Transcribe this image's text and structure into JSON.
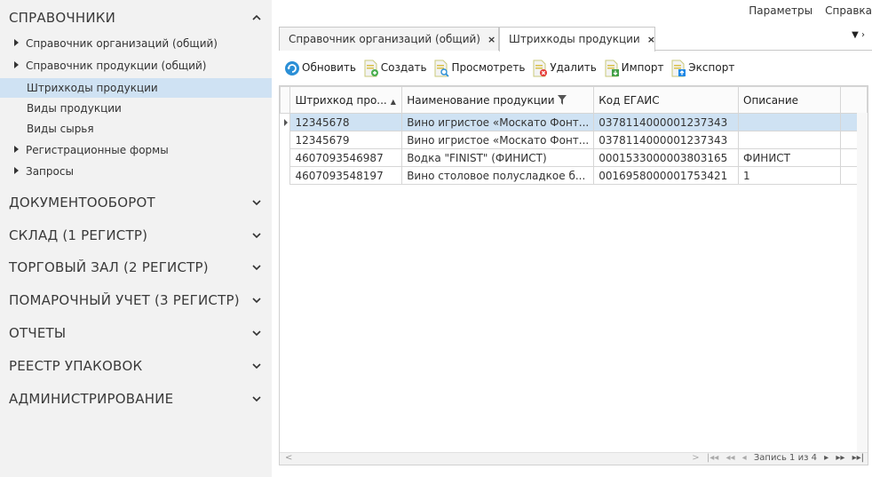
{
  "sidebar": {
    "sections": [
      {
        "label": "СПРАВОЧНИКИ",
        "expanded": true
      },
      {
        "label": "ДОКУМЕНТООБОРОТ",
        "expanded": false
      },
      {
        "label": "СКЛАД (1 РЕГИСТР)",
        "expanded": false
      },
      {
        "label": "ТОРГОВЫЙ ЗАЛ (2 РЕГИСТР)",
        "expanded": false
      },
      {
        "label": "ПОМАРОЧНЫЙ УЧЕТ (3 РЕГИСТР)",
        "expanded": false
      },
      {
        "label": "ОТЧЕТЫ",
        "expanded": false
      },
      {
        "label": "РЕЕСТР УПАКОВОК",
        "expanded": false
      },
      {
        "label": "АДМИНИСТРИРОВАНИЕ",
        "expanded": false
      }
    ],
    "items": [
      {
        "label": "Справочник организаций (общий)",
        "has_children": true
      },
      {
        "label": "Справочник продукции (общий)",
        "has_children": true
      },
      {
        "label": "Штрихкоды продукции",
        "selected": true
      },
      {
        "label": "Виды продукции"
      },
      {
        "label": "Виды сырья"
      },
      {
        "label": "Регистрационные формы",
        "has_children": true
      },
      {
        "label": "Запросы",
        "has_children": true
      }
    ]
  },
  "topmenu": {
    "params": "Параметры",
    "help": "Справка"
  },
  "tabs": [
    {
      "label": "Справочник организаций (общий)",
      "close": "×"
    },
    {
      "label": "Штрихкоды продукции",
      "close": "×",
      "active": true
    }
  ],
  "toolbar": {
    "refresh": "Обновить",
    "create": "Создать",
    "view": "Просмотреть",
    "delete": "Удалить",
    "import": "Импорт",
    "export": "Экспорт"
  },
  "table": {
    "columns": [
      "Штрихкод про...",
      "Наименование продукции",
      "Код ЕГАИС",
      "Описание"
    ],
    "rows": [
      [
        "12345678",
        "Вино игристое «Москато Фонт...",
        "0378114000001237343",
        ""
      ],
      [
        "12345679",
        "Вино игристое «Москато Фонт...",
        "0378114000001237343",
        ""
      ],
      [
        "4607093546987",
        "Водка \"FINIST\" (ФИНИСТ)",
        "0001533000003803165",
        "ФИНИСТ"
      ],
      [
        "4607093548197",
        "Вино столовое полусладкое б...",
        "0016958000001753421",
        "1"
      ]
    ],
    "selected_row": 0
  },
  "pager": {
    "record": "Запись 1 из 4"
  },
  "colors": {
    "sidebar_bg": "#f2f2f2",
    "selection": "#cfe2f3"
  },
  "icons": [
    "refresh-icon",
    "create-doc-icon",
    "view-doc-icon",
    "delete-doc-icon",
    "import-doc-icon",
    "export-doc-icon",
    "chevron-up-icon",
    "chevron-down-icon",
    "filter-icon"
  ]
}
